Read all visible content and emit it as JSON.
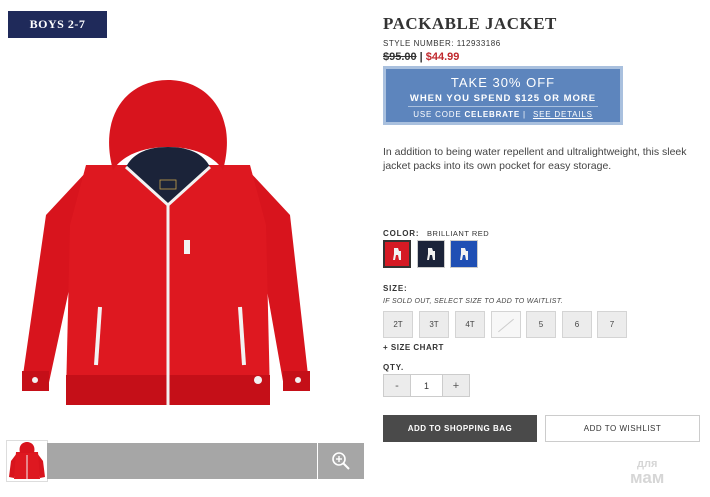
{
  "badge": "BOYS 2-7",
  "product": {
    "title": "PACKABLE JACKET",
    "style_label": "STYLE NUMBER:",
    "style_number": "112933186",
    "price_old": "$95.00",
    "price_sep": "|",
    "price_new": "$44.99",
    "description": "In addition to being water repellent and ultralightweight, this sleek jacket packs into its own pocket for easy storage."
  },
  "promo": {
    "headline": "TAKE 30% OFF",
    "subline": "WHEN YOU SPEND $125 OR MORE",
    "code_prefix": "USE CODE",
    "code": "CELEBRATE",
    "divider": "|",
    "details_link": "SEE DETAILS",
    "color_bg": "#5d85bd"
  },
  "color": {
    "label": "COLOR:",
    "selected": "BRILLIANT RED",
    "swatches": [
      {
        "name": "red",
        "hex": "#d51a24"
      },
      {
        "name": "navy",
        "hex": "#1b2339"
      },
      {
        "name": "blue",
        "hex": "#1f4fb4"
      }
    ]
  },
  "size": {
    "label": "SIZE:",
    "note": "IF SOLD OUT, SELECT SIZE TO ADD TO WAITLIST.",
    "options": [
      "2T",
      "3T",
      "4T",
      "",
      "5",
      "6",
      "7"
    ],
    "chart_link": "+ SIZE CHART"
  },
  "qty": {
    "label": "QTY.",
    "minus": "-",
    "value": "1",
    "plus": "+"
  },
  "actions": {
    "add_to_bag": "ADD TO SHOPPING BAG",
    "add_to_wishlist": "ADD TO WISHLIST"
  },
  "watermark": {
    "line1": "для",
    "line2": "мам"
  },
  "icons": {
    "zoom": "magnifier-plus-icon"
  },
  "colors": {
    "badge_bg": "#1f2a5a",
    "sale_price": "#c0282d",
    "primary_button": "#4a4a4a"
  }
}
